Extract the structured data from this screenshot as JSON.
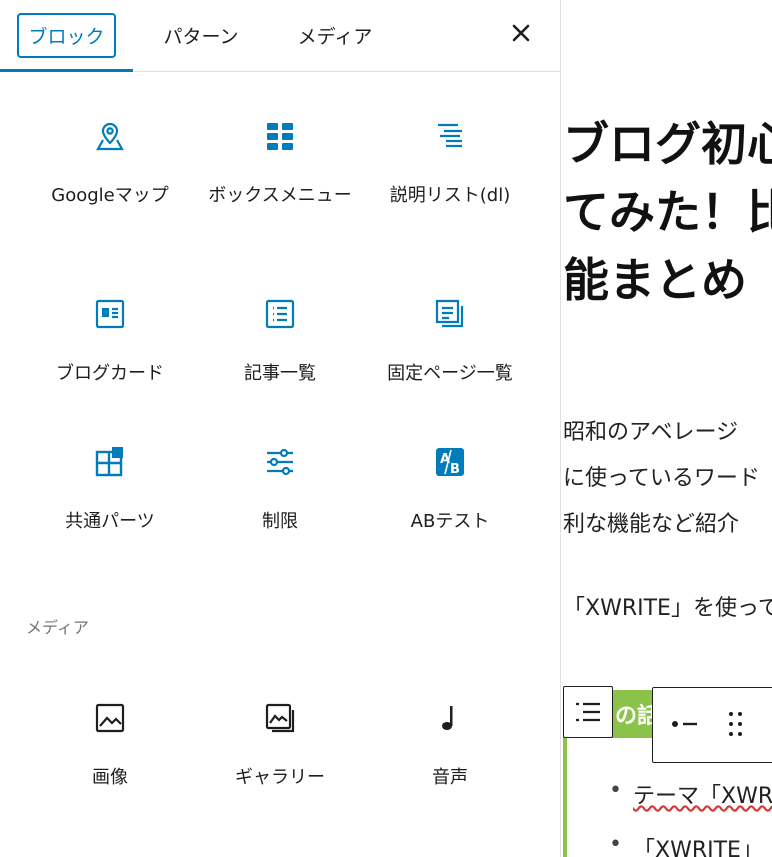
{
  "tabs": [
    {
      "label": "ブロック",
      "active": true
    },
    {
      "label": "パターン",
      "active": false
    },
    {
      "label": "メディア",
      "active": false
    }
  ],
  "close_icon": "close-icon",
  "accent_color": "#007cba",
  "blocks": [
    {
      "label": "Googleマップ",
      "icon": "map-pin-icon"
    },
    {
      "label": "ボックスメニュー",
      "icon": "grid-icon"
    },
    {
      "label": "説明リスト(dl)",
      "icon": "definition-list-icon"
    },
    {
      "label": "ブログカード",
      "icon": "blog-card-icon"
    },
    {
      "label": "記事一覧",
      "icon": "post-list-icon"
    },
    {
      "label": "固定ページ一覧",
      "icon": "page-list-icon"
    },
    {
      "label": "共通パーツ",
      "icon": "layout-parts-icon"
    },
    {
      "label": "制限",
      "icon": "sliders-icon"
    },
    {
      "label": "ABテスト",
      "icon": "ab-test-icon"
    }
  ],
  "media_section": {
    "title": "メディア",
    "blocks": [
      {
        "label": "画像",
        "icon": "image-icon"
      },
      {
        "label": "ギャラリー",
        "icon": "gallery-icon"
      },
      {
        "label": "音声",
        "icon": "audio-icon"
      }
    ]
  },
  "editor": {
    "title_lines": [
      "ブログ初心",
      "てみた！比",
      "能まとめ"
    ],
    "paragraph_lines": [
      "昭和のアベレージ",
      "に使っているワード",
      "利な機能など紹介"
    ],
    "paragraph2": "「XWRITE」を使って",
    "box_heading": "の話",
    "list_items": [
      "テーマ「XWRITE」",
      "「XWRITE」"
    ],
    "accent_green": "#8bc34a"
  }
}
